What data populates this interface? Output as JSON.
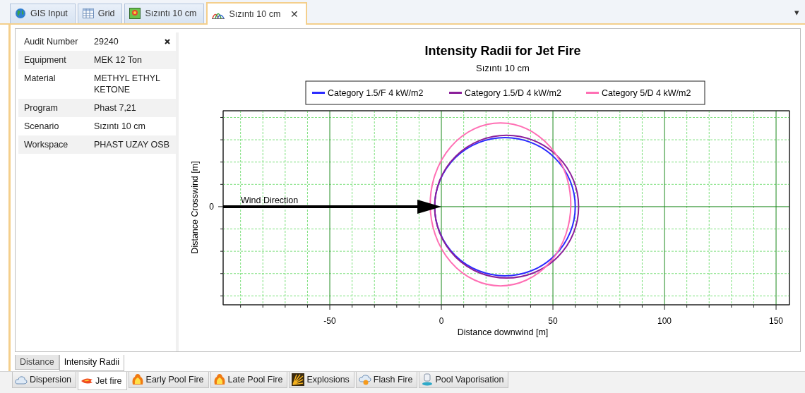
{
  "tabs": [
    {
      "kind": "globe",
      "label": "GIS Input",
      "selected": false
    },
    {
      "kind": "grid",
      "label": "Grid",
      "selected": false
    },
    {
      "kind": "map",
      "label": "Sızıntı 10 cm",
      "selected": false
    },
    {
      "kind": "chart",
      "label": "Sızıntı 10 cm",
      "selected": true,
      "close": "✕"
    }
  ],
  "tab_menu": "▾",
  "properties": [
    {
      "name": "Audit Number",
      "value": "29240"
    },
    {
      "name": "Equipment",
      "value": "MEK 12 Ton"
    },
    {
      "name": "Material",
      "value": "METHYL ETHYL KETONE"
    },
    {
      "name": "Program",
      "value": "Phast 7,21"
    },
    {
      "name": "Scenario",
      "value": "Sızıntı 10 cm"
    },
    {
      "name": "Workspace",
      "value": "PHAST UZAY OSB"
    }
  ],
  "chart": {
    "title": "Intensity Radii for Jet Fire",
    "subtitle": "Sızıntı 10 cm",
    "legend": [
      {
        "label": "Category 1.5/F 4 kW/m2",
        "color": "#2b2bff"
      },
      {
        "label": "Category 1.5/D 4 kW/m2",
        "color": "#8b1f9a"
      },
      {
        "label": "Category 5/D 4 kW/m2",
        "color": "#ff6fb4"
      }
    ],
    "x_axis": {
      "title": "Distance downwind [m]",
      "ticks": [
        "-50",
        "0",
        "50",
        "100",
        "150"
      ]
    },
    "y_axis": {
      "title": "Distance Crosswind [m]",
      "ticks": [
        "0"
      ]
    },
    "annotation": "Wind Direction"
  },
  "view_tabs": [
    {
      "label": "Distance",
      "selected": false
    },
    {
      "label": "Intensity Radii",
      "selected": true
    }
  ],
  "result_tabs": [
    {
      "kind": "cloud",
      "label": "Dispersion",
      "selected": false
    },
    {
      "kind": "jet",
      "label": "Jet fire",
      "selected": true
    },
    {
      "kind": "fire",
      "label": "Early Pool Fire",
      "selected": false
    },
    {
      "kind": "fire",
      "label": "Late Pool Fire",
      "selected": false
    },
    {
      "kind": "burst",
      "label": "Explosions",
      "selected": false
    },
    {
      "kind": "flash",
      "label": "Flash Fire",
      "selected": false
    },
    {
      "kind": "pool",
      "label": "Pool Vaporisation",
      "selected": false
    }
  ]
}
